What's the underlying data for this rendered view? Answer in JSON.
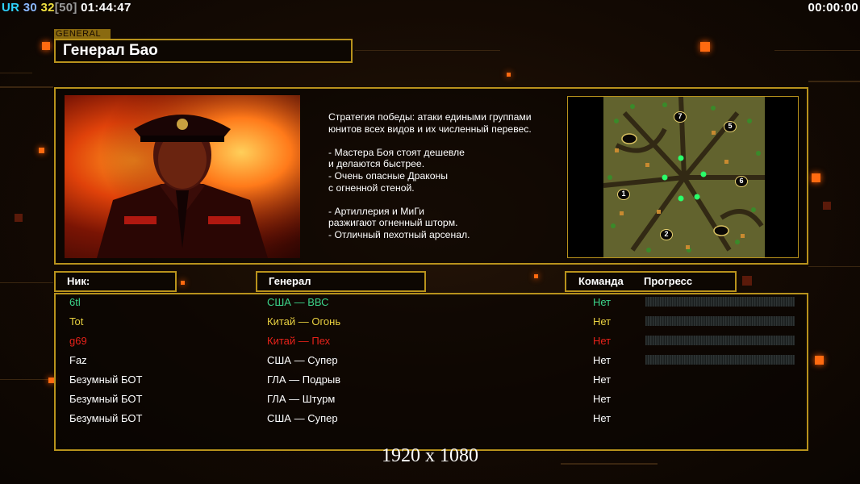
{
  "hud": {
    "prefix": "UR",
    "n1": "30",
    "n2": "32",
    "bracket_value": "[50]",
    "clock": "01:44:47",
    "timer": "00:00:00"
  },
  "general": {
    "tag": "GENERAL",
    "name": "Генерал Бао"
  },
  "description": [
    "Стратегия победы: атаки едиными группами",
    "юнитов всех видов и их численный перевес.",
    "",
    "- Мастера Боя стоят дешевле",
    "и делаются быстрее.",
    "- Очень опасные Драконы",
    "с огненной стеной.",
    "",
    "- Артиллерия и МиГи",
    "разжигают огненный шторм.",
    "- Отличный пехотный арсенал."
  ],
  "map": {
    "start_positions": [
      "7",
      "5",
      "1",
      "6",
      "2"
    ]
  },
  "table": {
    "headers": {
      "nick": "Ник:",
      "general": "Генерал",
      "team": "Команда",
      "progress": "Прогресс"
    },
    "rows": [
      {
        "nick": "6tl",
        "general": "США — ВВС",
        "team": "Нет",
        "color": "#3cd48a",
        "progress": 0
      },
      {
        "nick": "Tot",
        "general": "Китай — Огонь",
        "team": "Нет",
        "color": "#e8d040",
        "progress": 0
      },
      {
        "nick": "g69",
        "general": "Китай — Пех",
        "team": "Нет",
        "color": "#e8221a",
        "progress": 0
      },
      {
        "nick": "Faz",
        "general": "США — Супер",
        "team": "Нет",
        "color": "#ffffff",
        "progress": 0
      },
      {
        "nick": "Безумный БОТ",
        "general": "ГЛА — Подрыв",
        "team": "Нет",
        "color": "#ffffff"
      },
      {
        "nick": "Безумный БОТ",
        "general": "ГЛА — Штурм",
        "team": "Нет",
        "color": "#ffffff"
      },
      {
        "nick": "Безумный БОТ",
        "general": "США — Супер",
        "team": "Нет",
        "color": "#ffffff"
      }
    ]
  },
  "resolution_label": "1920 x 1080",
  "colors": {
    "frame": "#b8921c",
    "hud_prefix": "#2ed3ff",
    "hud_n1": "#8bb8ff",
    "hud_n2": "#f0e040",
    "hud_bracket": "#9a9a9a"
  }
}
